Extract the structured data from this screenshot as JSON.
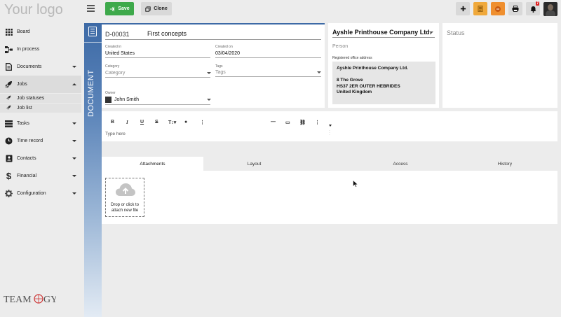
{
  "app": {
    "logo_text": "Your logo",
    "brand": "TEAMOGY"
  },
  "toolbar": {
    "save_label": "Save",
    "clone_label": "Clone",
    "notification_count": "7",
    "icons": [
      "menu-icon",
      "save-icon",
      "clone-icon",
      "plus-icon",
      "note-icon",
      "box-icon",
      "print-icon",
      "bell-icon"
    ]
  },
  "sidebar": {
    "items": [
      {
        "label": "Board",
        "icon": "grid-icon"
      },
      {
        "label": "In process",
        "icon": "process-icon"
      },
      {
        "label": "Documents",
        "icon": "document-icon"
      },
      {
        "label": "Jobs",
        "icon": "rocket-icon"
      },
      {
        "label": "Tasks",
        "icon": "tasks-icon"
      },
      {
        "label": "Time record",
        "icon": "clock-icon"
      },
      {
        "label": "Contacts",
        "icon": "contacts-icon"
      },
      {
        "label": "Financial",
        "icon": "dollar-icon"
      },
      {
        "label": "Configuration",
        "icon": "gear-icon"
      }
    ],
    "sub_items": [
      {
        "label": "Job statuses"
      },
      {
        "label": "Job list"
      }
    ]
  },
  "document": {
    "strip_label": "DOCUMENT",
    "id": "D-00031",
    "title": "First concepts",
    "created_in_label": "Created in",
    "created_in_value": "United States",
    "created_on_label": "Created on",
    "created_on_value": "03/04/2020",
    "category_label": "Category",
    "category_placeholder": "Category",
    "tags_label": "Tags",
    "tags_placeholder": "Tags",
    "owner_label": "Owner",
    "owner_value": "John Smith"
  },
  "company": {
    "name": "Ayshle Printhouse Company Ltd.",
    "person_placeholder": "Person",
    "registered_office_label": "Registered office address",
    "address": {
      "line1": "Ayshle Printhouse Company Ltd.",
      "line2": "",
      "line3": "8 The Grove",
      "line4": "HS37 2ER OUTER HEBRIDES",
      "line5": "United Kingdom"
    }
  },
  "status": {
    "label": "Status"
  },
  "editor": {
    "placeholder": "Type here",
    "tools": [
      "B",
      "I",
      "U",
      "S",
      "T↕",
      "◆",
      "⋮",
      "—",
      "▭",
      "🔗",
      "⋮"
    ]
  },
  "tabs": {
    "items": [
      {
        "label": "Attachments"
      },
      {
        "label": "Layout"
      },
      {
        "label": "Access"
      },
      {
        "label": "History"
      }
    ],
    "active": "Attachments"
  },
  "attachments": {
    "dropzone_line1": "Drop or click to",
    "dropzone_line2": "attach new file"
  },
  "colors": {
    "save_green": "#3ea94b",
    "doc_blue": "#3d6aa6",
    "note_orange": "#f0a93b",
    "box_orange": "#ef8f2f",
    "badge_red": "#dd2222"
  }
}
